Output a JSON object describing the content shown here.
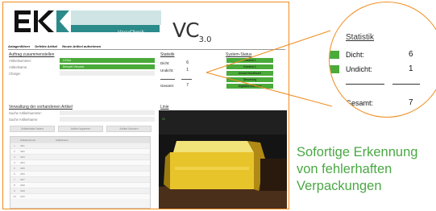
{
  "brand": {
    "product_name": "VacuCheck",
    "version_main": "VC",
    "version_sub": "3.0",
    "accent_color": "#f08c1e",
    "logo_color": "#111111",
    "teal_color": "#2b8a8a"
  },
  "menu": {
    "items": [
      {
        "label": "Anlagenführer"
      },
      {
        "label": "Defekte Artikel"
      },
      {
        "label": "Neuen Artikel aufnehmen"
      }
    ]
  },
  "auftrag": {
    "title": "Auftrag zusammenstellen",
    "artikelnummer_label": "Artikelnummer:",
    "artikelnummer_value": "t-034a",
    "artikelname_label": "Artikelname:",
    "artikelname_value": "Beispiel-Verpack.",
    "charge_label": "Charge:"
  },
  "statistik": {
    "title": "Statistik",
    "dicht_label": "Dicht:",
    "dicht_value": "6",
    "undicht_label": "Undicht:",
    "undicht_value": "1",
    "gesamt_label": "Gesamt:",
    "gesamt_value": "7"
  },
  "system_status": {
    "title": "System-Status",
    "items": [
      {
        "label": "Kamera 1"
      },
      {
        "label": "Kamera 2"
      },
      {
        "label": "Auswertesoftware"
      },
      {
        "label": "Steuerung"
      },
      {
        "label": "Digitales Interface"
      }
    ],
    "ok_color": "#4aaa3a"
  },
  "verwaltung": {
    "title": "Verwaltung der vorhandenen Artikel",
    "suche_nr_label": "Suche Artikelnummer:",
    "suche_name_label": "Suche Artikelname:",
    "buttons": [
      {
        "label": "Artikeldatei laden"
      },
      {
        "label": "Artikel kopieren"
      },
      {
        "label": "Artikel löschen"
      }
    ],
    "table_headers": [
      "",
      "Artikelnummer",
      "Artikelname"
    ],
    "row_ids": [
      "1",
      "2",
      "3",
      "4",
      "5",
      "6",
      "7",
      "8",
      "9",
      "10"
    ],
    "row_codes": [
      "t001",
      "t002",
      "t003",
      "t004",
      "t005",
      "t006",
      "t007",
      "t008",
      "t009",
      "t010"
    ]
  },
  "linie": {
    "title": "Linie",
    "camera_label": "ID"
  },
  "caption": {
    "line1": "Sofortige Erkennung",
    "line2": "von fehlerhaften",
    "line3": "Verpackungen",
    "color": "#4aa844"
  }
}
